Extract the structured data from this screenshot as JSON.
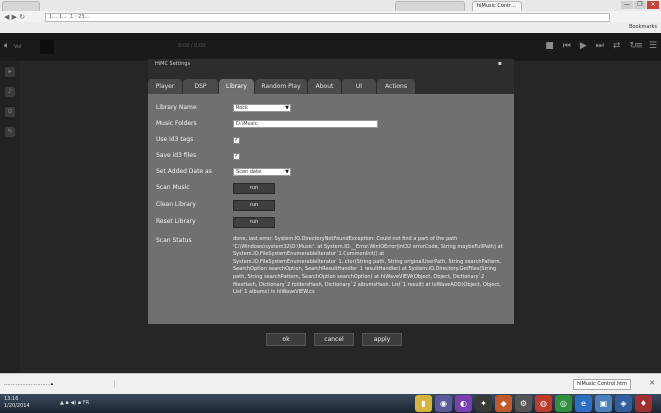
{
  "browser": {
    "tabs": [
      {
        "label": "",
        "left": 0
      },
      {
        "label": "",
        "left": 0
      },
      {
        "label": "hiMusic Contr…",
        "left": 0
      }
    ],
    "url": "1… 1… .1 : 23…",
    "bookmarks_label": "Bookmarks",
    "window_buttons": [
      "—",
      "❐",
      "✕"
    ]
  },
  "app": {
    "volume_label": "Vol",
    "time_text": "0:00 / 0:00",
    "controls": [
      "■",
      "⏮",
      "▶",
      "⏭",
      "⇄",
      "↻"
    ],
    "right_controls": [
      "≡",
      "☰"
    ],
    "left_buttons": [
      "▸",
      "♪",
      "⊙",
      "✎"
    ]
  },
  "dialog": {
    "title": "HiMC Settings",
    "close": "▪",
    "tabs": [
      "Player",
      "DSP",
      "Library",
      "Random Play",
      "About",
      "UI",
      "Actions"
    ],
    "active_tab": "Library",
    "library": {
      "library_name_label": "Library Name",
      "library_name_value": "Rock",
      "music_folders_label": "Music Folders",
      "music_folders_value": "D:\\Music",
      "use_id3_label": "Use id3 tags",
      "use_id3_checked": "✓",
      "save_id3_label": "Save id3 files",
      "save_id3_checked": "✓",
      "set_added_date_label": "Set Added Date as",
      "set_added_date_value": "Scan date",
      "scan_music_label": "Scan Music",
      "clean_library_label": "Clean Library",
      "reset_library_label": "Reset Library",
      "run_label": "run",
      "scan_status_label": "Scan Status",
      "scan_status_value": "done, last error: System.IO.DirectoryNotFoundException: Could not find a part of the path 'C:\\Windows\\system32\\D:\\Music'. at System.IO.__Error.WinIOError(Int32 errorCode, String maybeFullPath) at System.IO.FileSystemEnumerableIterator`1.CommonInit() at System.IO.FileSystemEnumerableIterator`1..ctor(String path, String originalUserPath, String searchPattern, SearchOption searchOption, SearchResultHandler`1 resultHandler) at System.IO.Directory.GetFiles(String path, String searchPattern, SearchOption searchOption) at hiWaveVIEW(Object, Object, Dictionary`2 filesHash, Dictionary`2 foldersHash, Dictionary`2 albumsHash, List`1 result) at hiWaveADD(Object, Object, List`1 albums) in hiWaveVIEW.cs"
    },
    "buttons": {
      "ok": "ok",
      "cancel": "cancel",
      "apply": "apply"
    }
  },
  "downloads": {
    "item": "……………………… ▴",
    "right_label": "hiMusic Control.htm",
    "close": "✕"
  },
  "taskbar": {
    "time": "13:16",
    "date": "1/20/2014",
    "tray": "▲ ▪ ◀) ▪ FR",
    "tasks": [
      {
        "icon": "▮",
        "color": "#d6b53a"
      },
      {
        "icon": "◉",
        "color": "#5a5a9a"
      },
      {
        "icon": "◐",
        "color": "#7a3fb0"
      },
      {
        "icon": "✦",
        "color": "#3a3a3a"
      },
      {
        "icon": "◆",
        "color": "#c05a2a"
      },
      {
        "icon": "⚙",
        "color": "#555"
      },
      {
        "icon": "◍",
        "color": "#c0392b"
      },
      {
        "icon": "◎",
        "color": "#2f8f3f"
      },
      {
        "icon": "e",
        "color": "#2a6fc0"
      },
      {
        "icon": "▣",
        "color": "#4a7fc0"
      },
      {
        "icon": "◈",
        "color": "#2f5f9f"
      },
      {
        "icon": "♦",
        "color": "#a03030"
      }
    ]
  }
}
